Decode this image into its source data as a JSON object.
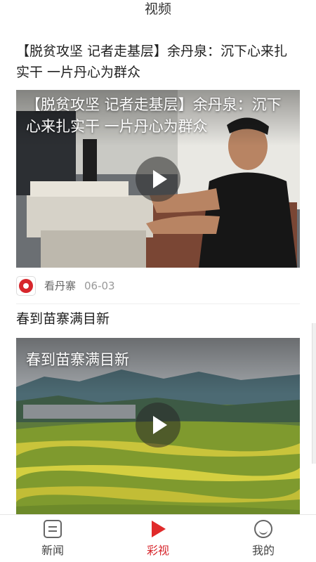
{
  "header": {
    "title": "视频"
  },
  "feed": [
    {
      "title": "【脱贫攻坚 记者走基层】余丹泉：沉下心来扎实干 一片丹心为群众",
      "overlay": "【脱贫攻坚 记者走基层】余丹泉：沉下心来扎实干 一片丹心为群众",
      "source": "看丹寨",
      "date": "06-03"
    },
    {
      "title": "春到苗寨满目新",
      "overlay": "春到苗寨满目新"
    }
  ],
  "nav": [
    {
      "label": "新闻",
      "icon": "news-icon"
    },
    {
      "label": "彩视",
      "icon": "video-play-icon",
      "active": true
    },
    {
      "label": "我的",
      "icon": "profile-icon"
    }
  ],
  "colors": {
    "accent": "#d7262c"
  }
}
